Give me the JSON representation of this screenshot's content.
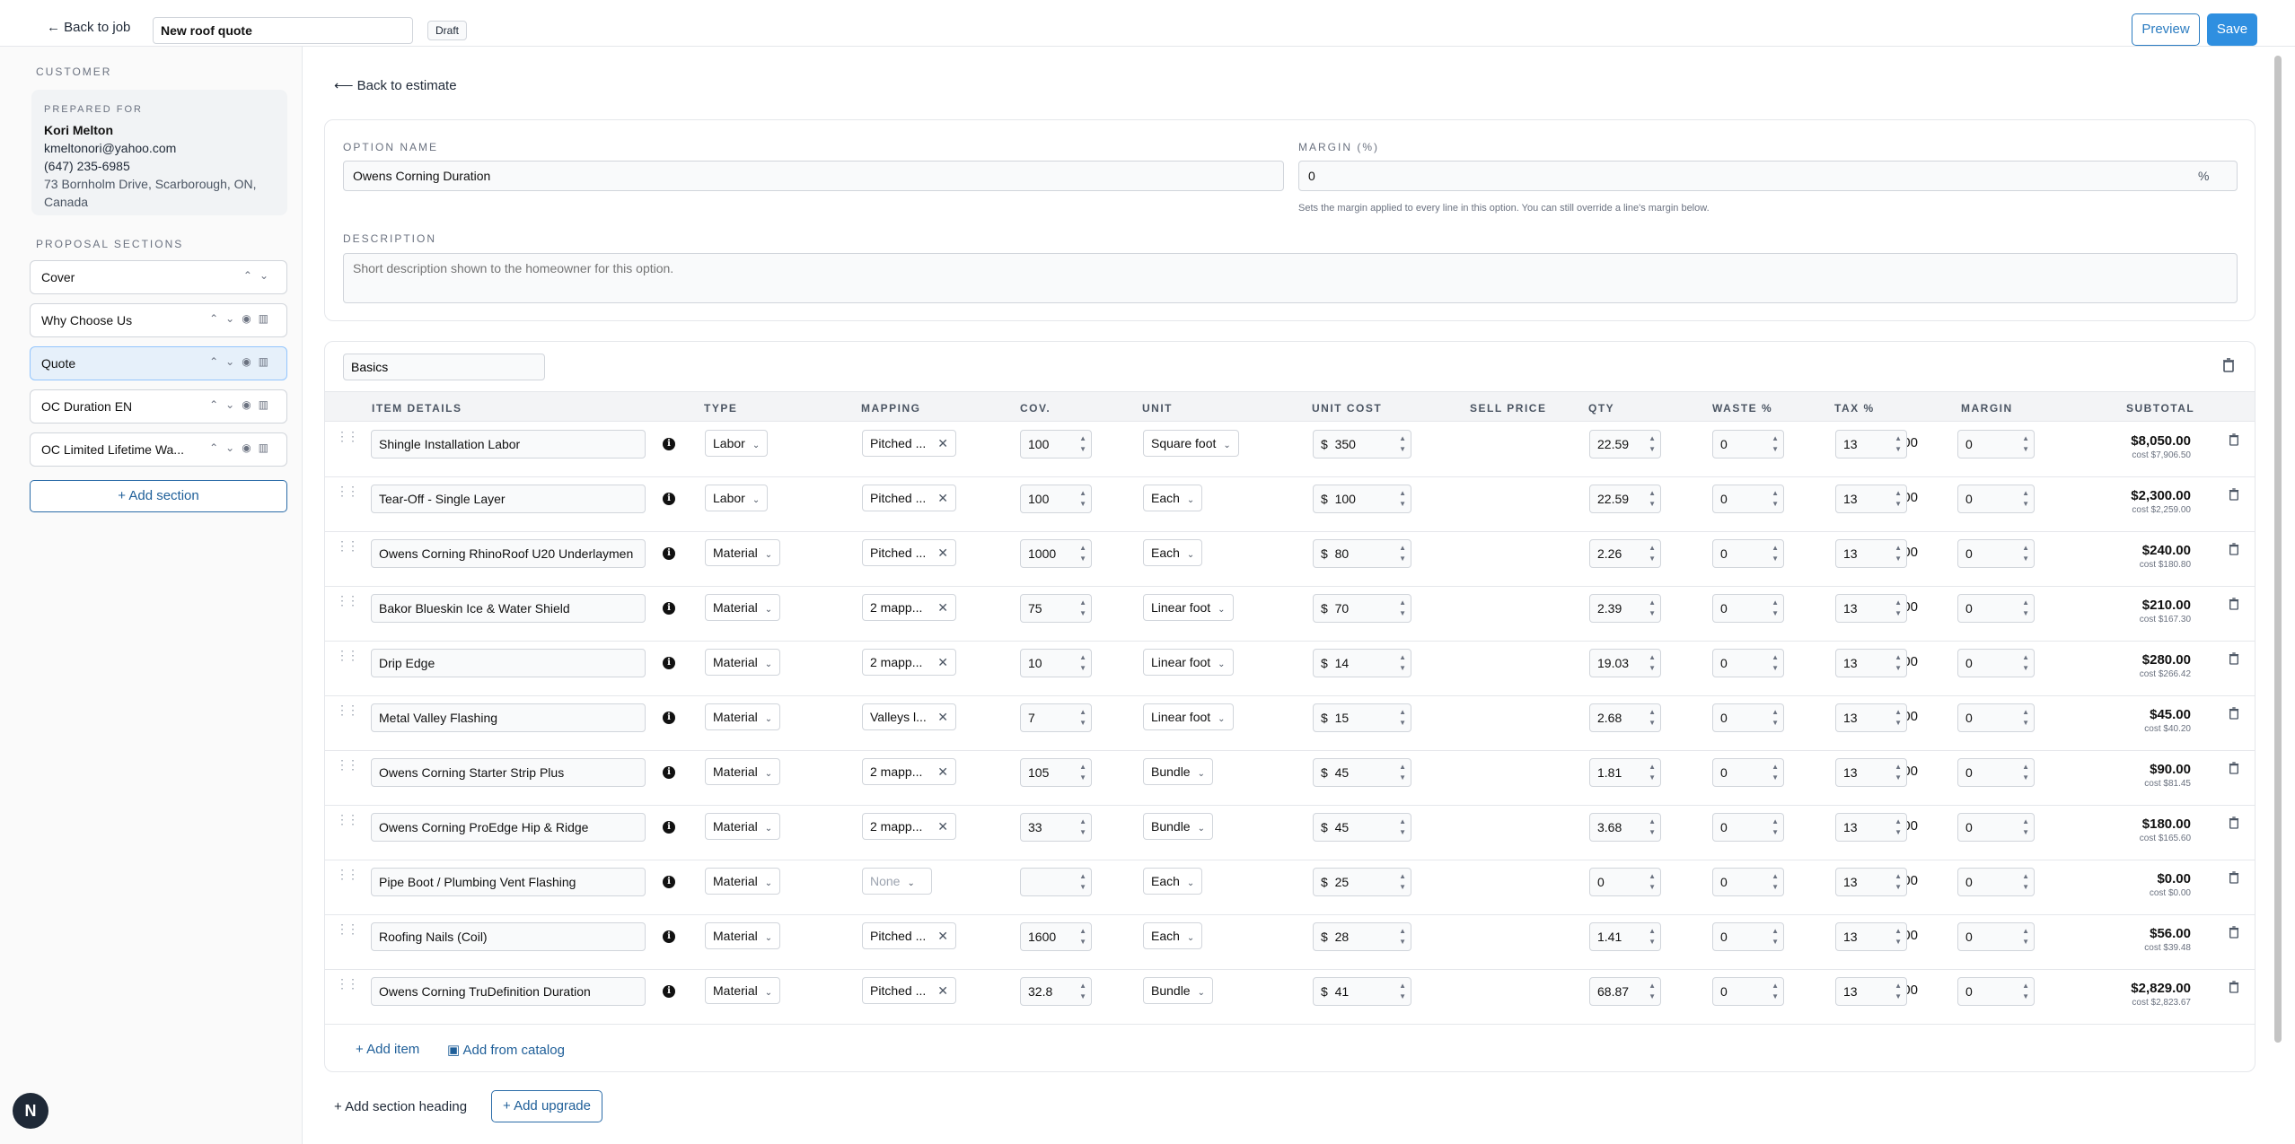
{
  "topbar": {
    "back": "← Back to job",
    "title": "New roof quote",
    "status": "Draft",
    "preview": "Preview",
    "save": "Save"
  },
  "sidebar": {
    "customer_label": "CUSTOMER",
    "prepared_for": "PREPARED FOR",
    "name": "Kori Melton",
    "email": "kmeltonori@yahoo.com",
    "phone": "(647) 235-6985",
    "address": "73 Bornholm Drive, Scarborough, ON, Canada",
    "sections_label": "PROPOSAL SECTIONS",
    "sections": [
      {
        "label": "Cover"
      },
      {
        "label": "Why Choose Us"
      },
      {
        "label": "Quote"
      },
      {
        "label": "OC Duration EN"
      },
      {
        "label": "OC Limited Lifetime Wa..."
      }
    ],
    "add_section": "+ Add section"
  },
  "main": {
    "back": "Back to estimate",
    "option_name_label": "OPTION NAME",
    "option_name": "Owens Corning Duration",
    "margin_label": "MARGIN (%)",
    "margin": "0",
    "margin_unit": "%",
    "margin_hint": "Sets the margin applied to every line in this option. You can still override a line's margin below.",
    "description_label": "DESCRIPTION",
    "description_placeholder": "Short description shown to the homeowner for this option.",
    "group_name": "Basics",
    "columns": [
      "ITEM DETAILS",
      "TYPE",
      "MAPPING",
      "COV.",
      "UNIT",
      "UNIT COST",
      "SELL PRICE",
      "QTY",
      "WASTE %",
      "TAX %",
      "MARGIN",
      "SUBTOTAL"
    ],
    "currency": "$",
    "rows": [
      {
        "item": "Shingle Installation Labor",
        "type": "Labor",
        "mapping": "Pitched ...",
        "cov": "100",
        "unit": "Square foot",
        "unit_cost": "350",
        "sell": "$350.00",
        "qty": "22.59",
        "waste": "0",
        "tax": "13",
        "margin": "0",
        "subtotal": "$8,050.00",
        "cost": "cost $7,906.50"
      },
      {
        "item": "Tear-Off - Single Layer",
        "type": "Labor",
        "mapping": "Pitched ...",
        "cov": "100",
        "unit": "Each",
        "unit_cost": "100",
        "sell": "$100.00",
        "qty": "22.59",
        "waste": "0",
        "tax": "13",
        "margin": "0",
        "subtotal": "$2,300.00",
        "cost": "cost $2,259.00"
      },
      {
        "item": "Owens Corning RhinoRoof U20 Underlaymen",
        "type": "Material",
        "mapping": "Pitched ...",
        "cov": "1000",
        "unit": "Each",
        "unit_cost": "80",
        "sell": "$80.00",
        "qty": "2.26",
        "waste": "0",
        "tax": "13",
        "margin": "0",
        "subtotal": "$240.00",
        "cost": "cost $180.80"
      },
      {
        "item": "Bakor Blueskin Ice & Water Shield",
        "type": "Material",
        "mapping": "2 mapp...",
        "cov": "75",
        "unit": "Linear foot",
        "unit_cost": "70",
        "sell": "$70.00",
        "qty": "2.39",
        "waste": "0",
        "tax": "13",
        "margin": "0",
        "subtotal": "$210.00",
        "cost": "cost $167.30"
      },
      {
        "item": "Drip Edge",
        "type": "Material",
        "mapping": "2 mapp...",
        "cov": "10",
        "unit": "Linear foot",
        "unit_cost": "14",
        "sell": "$14.00",
        "qty": "19.03",
        "waste": "0",
        "tax": "13",
        "margin": "0",
        "subtotal": "$280.00",
        "cost": "cost $266.42"
      },
      {
        "item": "Metal Valley Flashing",
        "type": "Material",
        "mapping": "Valleys l...",
        "cov": "7",
        "unit": "Linear foot",
        "unit_cost": "15",
        "sell": "$15.00",
        "qty": "2.68",
        "waste": "0",
        "tax": "13",
        "margin": "0",
        "subtotal": "$45.00",
        "cost": "cost $40.20"
      },
      {
        "item": "Owens Corning Starter Strip Plus",
        "type": "Material",
        "mapping": "2 mapp...",
        "cov": "105",
        "unit": "Bundle",
        "unit_cost": "45",
        "sell": "$45.00",
        "qty": "1.81",
        "waste": "0",
        "tax": "13",
        "margin": "0",
        "subtotal": "$90.00",
        "cost": "cost $81.45"
      },
      {
        "item": "Owens Corning ProEdge Hip & Ridge",
        "type": "Material",
        "mapping": "2 mapp...",
        "cov": "33",
        "unit": "Bundle",
        "unit_cost": "45",
        "sell": "$45.00",
        "qty": "3.68",
        "waste": "0",
        "tax": "13",
        "margin": "0",
        "subtotal": "$180.00",
        "cost": "cost $165.60"
      },
      {
        "item": "Pipe Boot / Plumbing Vent Flashing",
        "type": "Material",
        "mapping": "None",
        "cov": "",
        "unit": "Each",
        "unit_cost": "25",
        "sell": "$25.00",
        "qty": "0",
        "waste": "0",
        "tax": "13",
        "margin": "0",
        "subtotal": "$0.00",
        "cost": "cost $0.00"
      },
      {
        "item": "Roofing Nails (Coil)",
        "type": "Material",
        "mapping": "Pitched ...",
        "cov": "1600",
        "unit": "Each",
        "unit_cost": "28",
        "sell": "$28.00",
        "qty": "1.41",
        "waste": "0",
        "tax": "13",
        "margin": "0",
        "subtotal": "$56.00",
        "cost": "cost $39.48"
      },
      {
        "item": "Owens Corning TruDefinition Duration",
        "type": "Material",
        "mapping": "Pitched ...",
        "cov": "32.8",
        "unit": "Bundle",
        "unit_cost": "41",
        "sell": "$41.00",
        "qty": "68.87",
        "waste": "0",
        "tax": "13",
        "margin": "0",
        "subtotal": "$2,829.00",
        "cost": "cost $2,823.67"
      }
    ],
    "add_item": "+ Add item",
    "add_catalog": "Add from catalog",
    "add_heading": "+ Add section heading",
    "add_upgrade": "+ Add upgrade"
  },
  "fab": "N"
}
